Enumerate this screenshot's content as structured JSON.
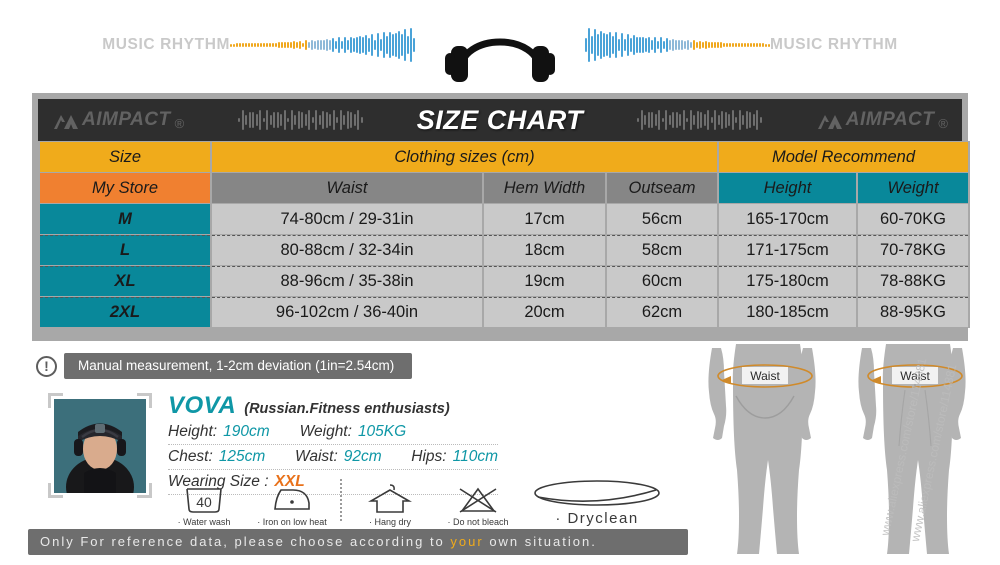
{
  "banner": {
    "left_text": "MUSIC RHYTHM",
    "right_text": "MUSIC RHYTHM",
    "headphones_icon": "headphones-icon"
  },
  "header": {
    "title": "SIZE CHART",
    "logo_text": "AIMPACT",
    "logo_mark": "aimpact-logo-icon",
    "logo_registered": "®"
  },
  "table": {
    "group_headers": [
      {
        "label": "Size",
        "style": "gold"
      },
      {
        "label": "Clothing sizes  (cm)",
        "style": "gold"
      },
      {
        "label": "Model Recommend",
        "style": "gold"
      }
    ],
    "columns": [
      {
        "label": "My Store",
        "style": "orange"
      },
      {
        "label": "Waist",
        "style": "gray"
      },
      {
        "label": "Hem Width",
        "style": "gray"
      },
      {
        "label": "Outseam",
        "style": "gray"
      },
      {
        "label": "Height",
        "style": "teal"
      },
      {
        "label": "Weight",
        "style": "teal"
      }
    ],
    "rows": [
      {
        "size": "M",
        "waist": "74-80cm / 29-31in",
        "hem": "17cm",
        "outseam": "56cm",
        "height": "165-170cm",
        "weight": "60-70KG"
      },
      {
        "size": "L",
        "waist": "80-88cm / 32-34in",
        "hem": "18cm",
        "outseam": "58cm",
        "height": "171-175cm",
        "weight": "70-78KG"
      },
      {
        "size": "XL",
        "waist": "88-96cm / 35-38in",
        "hem": "19cm",
        "outseam": "60cm",
        "height": "175-180cm",
        "weight": "78-88KG"
      },
      {
        "size": "2XL",
        "waist": "96-102cm / 36-40in",
        "hem": "20cm",
        "outseam": "62cm",
        "height": "180-185cm",
        "weight": "88-95KG"
      }
    ]
  },
  "notice": {
    "icon": "exclamation-circle-icon",
    "icon_glyph": "!",
    "text": "Manual measurement, 1-2cm deviation (1in=2.54cm)"
  },
  "model": {
    "photo_name": "model-portrait",
    "name": "VOVA",
    "nationality": "(Russian.Fitness enthusiasts)",
    "height_label": "Height:",
    "height_value": "190cm",
    "weight_label": "Weight:",
    "weight_value": "105KG",
    "chest_label": "Chest:",
    "chest_value": "125cm",
    "waist_label": "Waist:",
    "waist_value": "92cm",
    "hips_label": "Hips:",
    "hips_value": "110cm",
    "wearing_label": "Wearing Size :",
    "wearing_value": "XXL"
  },
  "care": [
    {
      "icon": "water-wash-icon",
      "label": "· Water wash",
      "temp": "40"
    },
    {
      "icon": "iron-low-heat-icon",
      "label": "· Iron on low heat"
    },
    {
      "icon": "hang-dry-icon",
      "label": "· Hang dry"
    },
    {
      "icon": "do-not-bleach-icon",
      "label": "· Do not bleach"
    },
    {
      "icon": "dryclean-icon",
      "label": "· Dryclean"
    }
  ],
  "footer": {
    "prefix": "Only For reference data, please choose according to ",
    "highlight": "your",
    "suffix": " own situation."
  },
  "bodies": {
    "back_waist_label": "Waist",
    "front_waist_label": "Waist",
    "watermark": "www.aliexpress.com/store/114881"
  },
  "colors": {
    "gold": "#f0ab1b",
    "orange": "#f08030",
    "teal": "#09889a",
    "gray_header": "#868686",
    "cell_gray": "#c9c9c9",
    "frame_gray": "#a8a8a8",
    "dark_band": "#2e2e2e",
    "size_text_yellow": "#f3f52a",
    "accent_cyan": "#0f97a6"
  }
}
